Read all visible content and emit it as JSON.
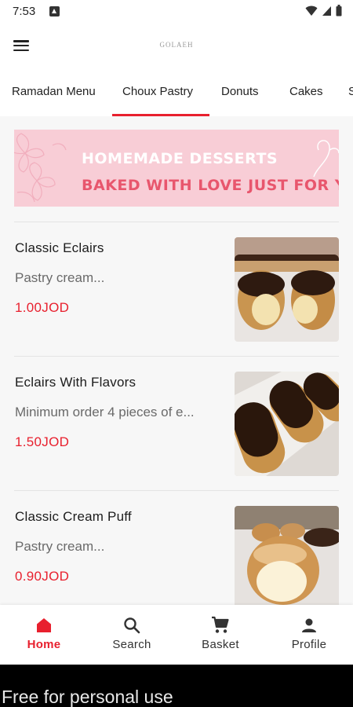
{
  "status_bar": {
    "time": "7:53"
  },
  "app_bar": {
    "logo_text": "GOLAEH"
  },
  "tabs": [
    {
      "label": "Ramadan Menu",
      "active": false
    },
    {
      "label": "Choux Pastry",
      "active": true
    },
    {
      "label": "Donuts",
      "active": false
    },
    {
      "label": "Cakes",
      "active": false
    },
    {
      "label": "S",
      "active": false
    }
  ],
  "banner": {
    "line1": "HOMEMADE DESSERTS",
    "line2": "BAKED WITH LOVE JUST FOR YO"
  },
  "products": [
    {
      "name": "Classic Eclairs",
      "description": "Pastry cream...",
      "price": "1.00JOD"
    },
    {
      "name": "Eclairs With Flavors",
      "description": "Minimum order 4 pieces of e...",
      "price": "1.50JOD"
    },
    {
      "name": "Classic Cream Puff",
      "description": "Pastry cream...",
      "price": "0.90JOD"
    }
  ],
  "bottom_nav": [
    {
      "label": "Home",
      "icon": "home-icon",
      "active": true
    },
    {
      "label": "Search",
      "icon": "search-icon",
      "active": false
    },
    {
      "label": "Basket",
      "icon": "cart-icon",
      "active": false
    },
    {
      "label": "Profile",
      "icon": "person-icon",
      "active": false
    }
  ],
  "watermark": "Free for personal use",
  "colors": {
    "accent": "#e8202e",
    "banner_bg": "#f8cdd6",
    "banner_text_pink": "#e8566d"
  }
}
